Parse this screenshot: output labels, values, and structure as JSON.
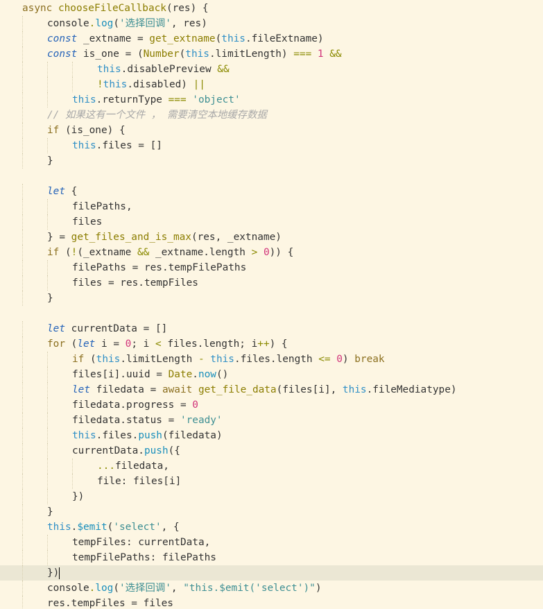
{
  "editor": {
    "language": "javascript",
    "cursor_line": 37,
    "lines": [
      {
        "indent": 0,
        "tokens": [
          {
            "t": "async ",
            "c": "kw"
          },
          {
            "t": "chooseFileCallback",
            "c": "func"
          },
          {
            "t": "(res) {"
          }
        ]
      },
      {
        "indent": 1,
        "tokens": [
          {
            "t": "console"
          },
          {
            "t": ".",
            "c": "op"
          },
          {
            "t": "log",
            "c": "meth"
          },
          {
            "t": "("
          },
          {
            "t": "'选择回调'",
            "c": "str"
          },
          {
            "t": ", res)"
          }
        ]
      },
      {
        "indent": 1,
        "tokens": [
          {
            "t": "const",
            "c": "kwi"
          },
          {
            "t": " _extname = "
          },
          {
            "t": "get_extname",
            "c": "func"
          },
          {
            "t": "("
          },
          {
            "t": "this",
            "c": "this"
          },
          {
            "t": "."
          },
          {
            "t": "fileExtname"
          },
          {
            "t": ")"
          }
        ]
      },
      {
        "indent": 1,
        "tokens": [
          {
            "t": "const",
            "c": "kwi"
          },
          {
            "t": " is_one = ("
          },
          {
            "t": "Number",
            "c": "func"
          },
          {
            "t": "("
          },
          {
            "t": "this",
            "c": "this"
          },
          {
            "t": ".limitLength) "
          },
          {
            "t": "===",
            "c": "op"
          },
          {
            "t": " "
          },
          {
            "t": "1",
            "c": "num"
          },
          {
            "t": " "
          },
          {
            "t": "&&",
            "c": "op"
          }
        ]
      },
      {
        "indent": 3,
        "tokens": [
          {
            "t": "this",
            "c": "this"
          },
          {
            "t": ".disablePreview "
          },
          {
            "t": "&&",
            "c": "op"
          }
        ]
      },
      {
        "indent": 3,
        "tokens": [
          {
            "t": "!",
            "c": "op"
          },
          {
            "t": "this",
            "c": "this"
          },
          {
            "t": ".disabled) "
          },
          {
            "t": "||",
            "c": "op"
          }
        ]
      },
      {
        "indent": 2,
        "tokens": [
          {
            "t": "this",
            "c": "this"
          },
          {
            "t": ".returnType "
          },
          {
            "t": "===",
            "c": "op"
          },
          {
            "t": " "
          },
          {
            "t": "'object'",
            "c": "str"
          }
        ]
      },
      {
        "indent": 1,
        "tokens": [
          {
            "t": "// 如果这有一个文件 ， 需要清空本地缓存数据",
            "c": "cmt"
          }
        ]
      },
      {
        "indent": 1,
        "tokens": [
          {
            "t": "if",
            "c": "kw"
          },
          {
            "t": " (is_one) {"
          }
        ]
      },
      {
        "indent": 2,
        "tokens": [
          {
            "t": "this",
            "c": "this"
          },
          {
            "t": ".files = []"
          }
        ]
      },
      {
        "indent": 1,
        "tokens": [
          {
            "t": "}"
          }
        ]
      },
      {
        "indent": 0,
        "tokens": []
      },
      {
        "indent": 1,
        "tokens": [
          {
            "t": "let",
            "c": "kwi"
          },
          {
            "t": " {"
          }
        ]
      },
      {
        "indent": 2,
        "tokens": [
          {
            "t": "filePaths,"
          }
        ]
      },
      {
        "indent": 2,
        "tokens": [
          {
            "t": "files"
          }
        ]
      },
      {
        "indent": 1,
        "tokens": [
          {
            "t": "} = "
          },
          {
            "t": "get_files_and_is_max",
            "c": "func"
          },
          {
            "t": "(res, _extname)"
          }
        ]
      },
      {
        "indent": 1,
        "tokens": [
          {
            "t": "if",
            "c": "kw"
          },
          {
            "t": " ("
          },
          {
            "t": "!",
            "c": "op"
          },
          {
            "t": "(_extname "
          },
          {
            "t": "&&",
            "c": "op"
          },
          {
            "t": " _extname.length "
          },
          {
            "t": ">",
            "c": "op"
          },
          {
            "t": " "
          },
          {
            "t": "0",
            "c": "num"
          },
          {
            "t": ")) {"
          }
        ]
      },
      {
        "indent": 2,
        "tokens": [
          {
            "t": "filePaths = res.tempFilePaths"
          }
        ]
      },
      {
        "indent": 2,
        "tokens": [
          {
            "t": "files = res.tempFiles"
          }
        ]
      },
      {
        "indent": 1,
        "tokens": [
          {
            "t": "}"
          }
        ]
      },
      {
        "indent": 0,
        "tokens": []
      },
      {
        "indent": 1,
        "tokens": [
          {
            "t": "let",
            "c": "kwi"
          },
          {
            "t": " currentData = []"
          }
        ]
      },
      {
        "indent": 1,
        "tokens": [
          {
            "t": "for",
            "c": "kw"
          },
          {
            "t": " ("
          },
          {
            "t": "let",
            "c": "kwi"
          },
          {
            "t": " i = "
          },
          {
            "t": "0",
            "c": "num"
          },
          {
            "t": "; i "
          },
          {
            "t": "<",
            "c": "op"
          },
          {
            "t": " files.length; i"
          },
          {
            "t": "++",
            "c": "op"
          },
          {
            "t": ") {"
          }
        ]
      },
      {
        "indent": 2,
        "tokens": [
          {
            "t": "if",
            "c": "kw"
          },
          {
            "t": " ("
          },
          {
            "t": "this",
            "c": "this"
          },
          {
            "t": ".limitLength "
          },
          {
            "t": "-",
            "c": "op"
          },
          {
            "t": " "
          },
          {
            "t": "this",
            "c": "this"
          },
          {
            "t": ".files.length "
          },
          {
            "t": "<=",
            "c": "op"
          },
          {
            "t": " "
          },
          {
            "t": "0",
            "c": "num"
          },
          {
            "t": ") "
          },
          {
            "t": "break",
            "c": "kw"
          }
        ]
      },
      {
        "indent": 2,
        "tokens": [
          {
            "t": "files[i].uuid = "
          },
          {
            "t": "Date",
            "c": "func"
          },
          {
            "t": "."
          },
          {
            "t": "now",
            "c": "meth"
          },
          {
            "t": "()"
          }
        ]
      },
      {
        "indent": 2,
        "tokens": [
          {
            "t": "let",
            "c": "kwi"
          },
          {
            "t": " filedata = "
          },
          {
            "t": "await",
            "c": "kw"
          },
          {
            "t": " "
          },
          {
            "t": "get_file_data",
            "c": "func"
          },
          {
            "t": "(files[i], "
          },
          {
            "t": "this",
            "c": "this"
          },
          {
            "t": ".fileMediatype)"
          }
        ]
      },
      {
        "indent": 2,
        "tokens": [
          {
            "t": "filedata.progress = "
          },
          {
            "t": "0",
            "c": "num"
          }
        ]
      },
      {
        "indent": 2,
        "tokens": [
          {
            "t": "filedata.status = "
          },
          {
            "t": "'ready'",
            "c": "str"
          }
        ]
      },
      {
        "indent": 2,
        "tokens": [
          {
            "t": "this",
            "c": "this"
          },
          {
            "t": ".files."
          },
          {
            "t": "push",
            "c": "meth"
          },
          {
            "t": "(filedata)"
          }
        ]
      },
      {
        "indent": 2,
        "tokens": [
          {
            "t": "currentData."
          },
          {
            "t": "push",
            "c": "meth"
          },
          {
            "t": "({"
          }
        ]
      },
      {
        "indent": 3,
        "tokens": [
          {
            "t": "...",
            "c": "op"
          },
          {
            "t": "filedata,"
          }
        ]
      },
      {
        "indent": 3,
        "tokens": [
          {
            "t": "file: files[i]"
          }
        ]
      },
      {
        "indent": 2,
        "tokens": [
          {
            "t": "})"
          }
        ]
      },
      {
        "indent": 1,
        "tokens": [
          {
            "t": "}"
          }
        ]
      },
      {
        "indent": 1,
        "tokens": [
          {
            "t": "this",
            "c": "this"
          },
          {
            "t": "."
          },
          {
            "t": "$emit",
            "c": "meth"
          },
          {
            "t": "("
          },
          {
            "t": "'select'",
            "c": "str"
          },
          {
            "t": ", {"
          }
        ]
      },
      {
        "indent": 2,
        "tokens": [
          {
            "t": "tempFiles: currentData,"
          }
        ]
      },
      {
        "indent": 2,
        "tokens": [
          {
            "t": "tempFilePaths: filePaths"
          }
        ]
      },
      {
        "indent": 1,
        "tokens": [
          {
            "t": "})"
          }
        ]
      },
      {
        "indent": 1,
        "tokens": [
          {
            "t": "console"
          },
          {
            "t": ".",
            "c": "op"
          },
          {
            "t": "log",
            "c": "meth"
          },
          {
            "t": "("
          },
          {
            "t": "'选择回调'",
            "c": "str"
          },
          {
            "t": ", "
          },
          {
            "t": "\"this.$emit('select')\"",
            "c": "str"
          },
          {
            "t": ")"
          }
        ]
      },
      {
        "indent": 1,
        "tokens": [
          {
            "t": "res.tempFiles = files"
          }
        ]
      }
    ]
  }
}
